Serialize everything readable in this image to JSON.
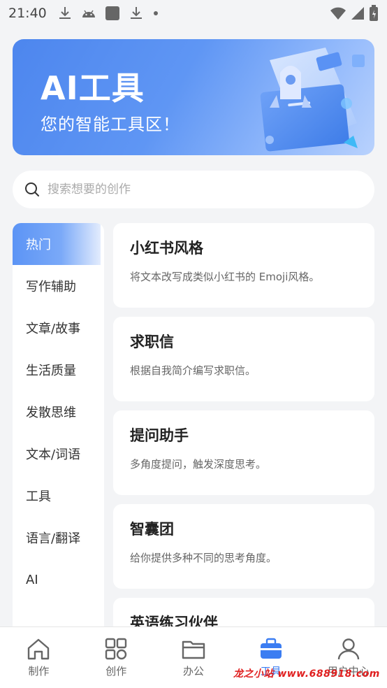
{
  "status_bar": {
    "time": "21:40"
  },
  "banner": {
    "title": "AI工具",
    "subtitle": "您的智能工具区！"
  },
  "search": {
    "placeholder": "搜索想要的创作"
  },
  "sidebar": {
    "items": [
      {
        "label": "热门",
        "active": true
      },
      {
        "label": "写作辅助"
      },
      {
        "label": "文章/故事"
      },
      {
        "label": "生活质量"
      },
      {
        "label": "发散思维"
      },
      {
        "label": "文本/词语"
      },
      {
        "label": "工具"
      },
      {
        "label": "语言/翻译"
      },
      {
        "label": "AI"
      }
    ]
  },
  "cards": [
    {
      "title": "小红书风格",
      "desc": "将文本改写成类似小红书的 Emoji风格。"
    },
    {
      "title": "求职信",
      "desc": "根据自我简介编写求职信。"
    },
    {
      "title": "提问助手",
      "desc": "多角度提问，触发深度思考。"
    },
    {
      "title": "智囊团",
      "desc": "给你提供多种不同的思考角度。"
    },
    {
      "title": "英语练习伙伴",
      "desc": ""
    }
  ],
  "bottom_nav": {
    "items": [
      {
        "label": "制作",
        "icon": "home-icon"
      },
      {
        "label": "创作",
        "icon": "grid-icon"
      },
      {
        "label": "办公",
        "icon": "folder-icon"
      },
      {
        "label": "工具",
        "icon": "toolbox-icon",
        "active": true
      },
      {
        "label": "用户中心",
        "icon": "user-icon"
      }
    ]
  },
  "watermark": "龙之小站 www.688918.com",
  "colors": {
    "accent": "#3b7df2",
    "banner_start": "#4d86ee",
    "banner_end": "#b9d2fd"
  }
}
